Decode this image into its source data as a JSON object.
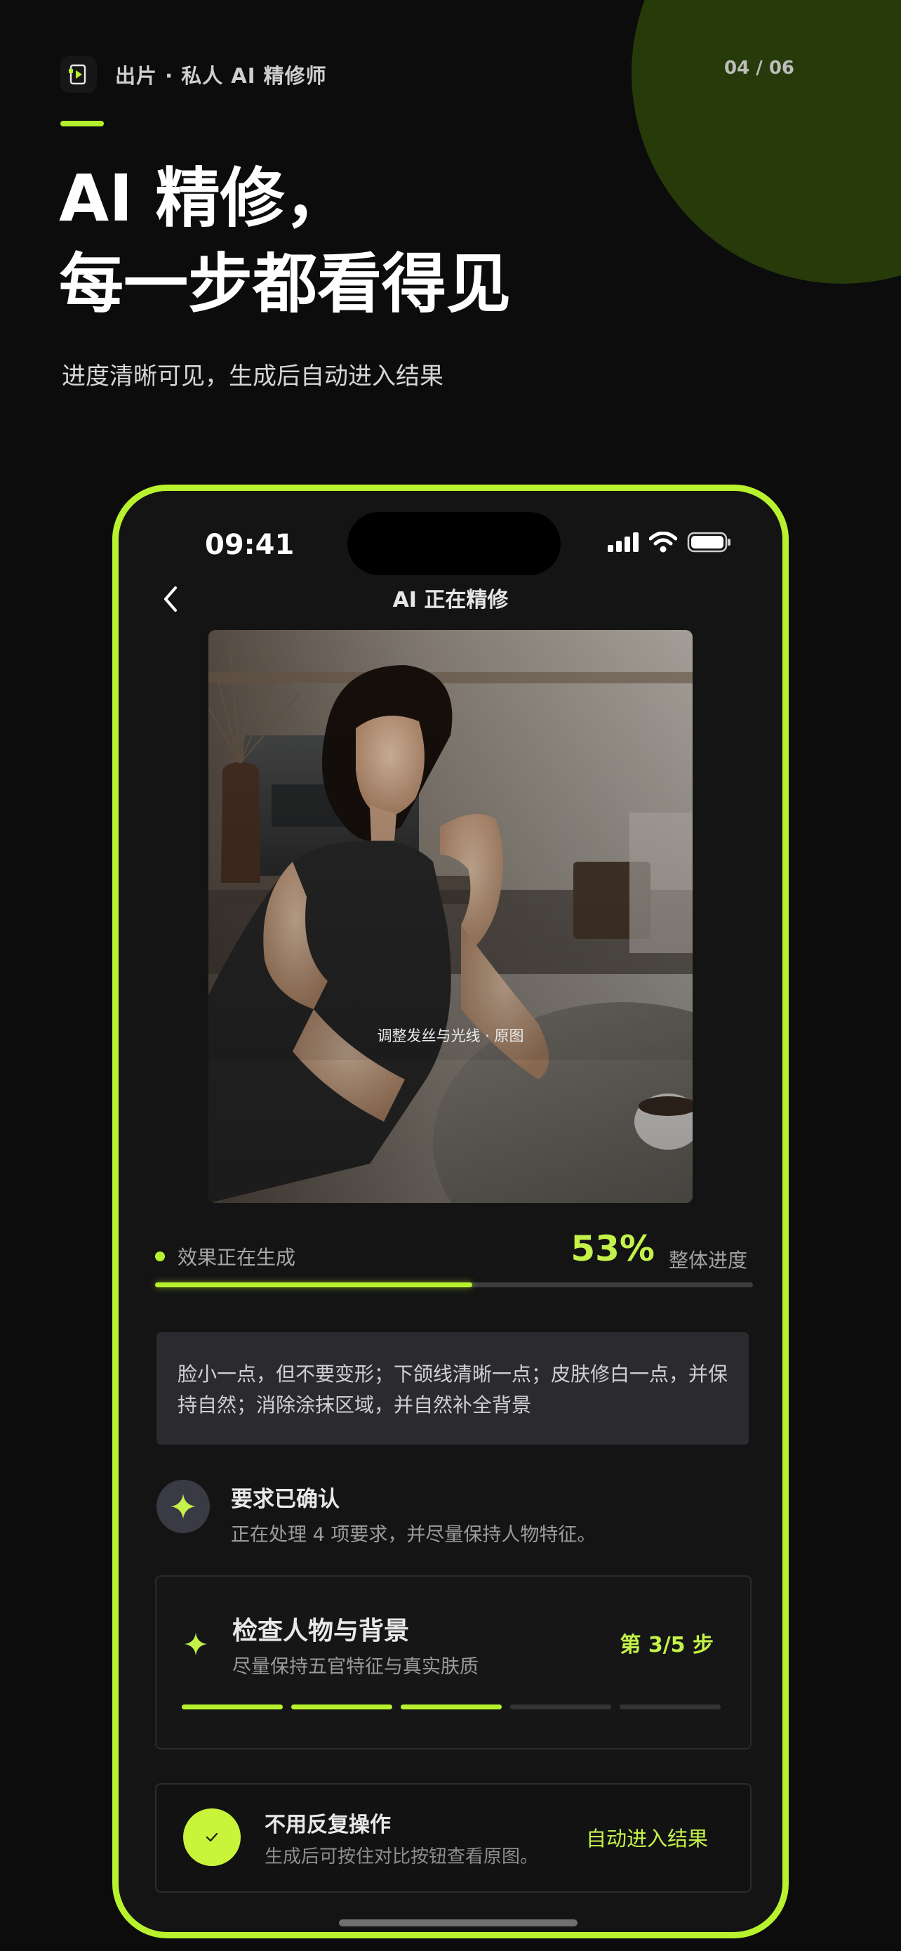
{
  "header": {
    "brand_name": "出片 · 私人 AI 精修师",
    "pager": "04 / 06",
    "hero_title_line1": "AI 精修，",
    "hero_title_line2": "每一步都看得见",
    "hero_subtitle": "进度清晰可见，生成后自动进入结果"
  },
  "phone": {
    "status_time": "09:41",
    "nav_title": "AI 正在精修",
    "photo_caption": "调整发丝与光线 · 原图",
    "progress": {
      "status_text": "效果正在生成",
      "percent_text": "53%",
      "label": "整体进度",
      "fraction": 0.53
    },
    "prompt": "脸小一点，但不要变形；下颌线清晰一点；皮肤修白一点，并保持自然；消除涂抹区域，并自然补全背景",
    "confirm": {
      "title": "要求已确认",
      "desc": "正在处理 4 项要求，并尽量保持人物特征。"
    },
    "step": {
      "title": "检查人物与背景",
      "desc": "尽量保持五官特征与真实肤质",
      "count": "第 3/5 步",
      "done": 3,
      "total": 5
    },
    "auto": {
      "title": "不用反复操作",
      "desc": "生成后可按住对比按钮查看原图。",
      "action": "自动进入结果"
    }
  },
  "colors": {
    "accent": "#b8f22e",
    "accent_text": "#c3f24a",
    "background": "#0c0c0c",
    "card": "#2b2a2f"
  },
  "icons": {
    "brand": "film-play-icon",
    "back": "chevron-left-icon",
    "signal": "signal-bars-icon",
    "wifi": "wifi-icon",
    "battery": "battery-icon",
    "sparkle": "sparkle-icon",
    "check": "check-icon"
  }
}
